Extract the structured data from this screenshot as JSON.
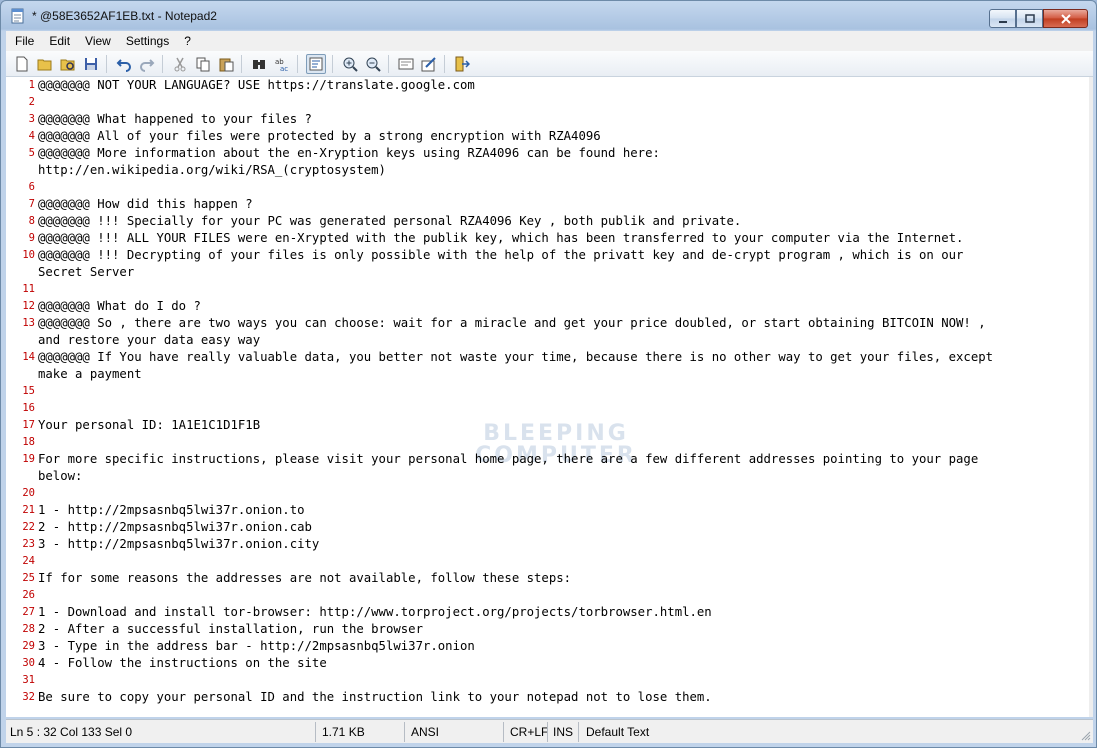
{
  "window": {
    "title": "* @58E3652AF1EB.txt - Notepad2"
  },
  "menu": [
    "File",
    "Edit",
    "View",
    "Settings",
    "?"
  ],
  "toolbar": {
    "buttons": [
      "new-icon",
      "open-icon",
      "browse-icon",
      "save-icon",
      "undo-icon",
      "redo-icon",
      "cut-icon",
      "copy-icon",
      "paste-icon",
      "find-icon",
      "replace-icon",
      "word-wrap-icon",
      "zoom-in-icon",
      "zoom-out-icon",
      "scheme-icon",
      "customize-icon",
      "exit-icon"
    ]
  },
  "editor": {
    "lines": [
      {
        "n": "1",
        "text": "@@@@@@@ NOT YOUR LANGUAGE? USE https://translate.google.com"
      },
      {
        "n": "2",
        "text": ""
      },
      {
        "n": "3",
        "text": "@@@@@@@ What happened to your files ?"
      },
      {
        "n": "4",
        "text": "@@@@@@@ All of your files were protected by a strong encryption with RZA4096"
      },
      {
        "n": "5",
        "text": "@@@@@@@ More information about the en-Xryption keys using RZA4096 can be found here:"
      },
      {
        "n": "",
        "text": "http://en.wikipedia.org/wiki/RSA_(cryptosystem)"
      },
      {
        "n": "6",
        "text": ""
      },
      {
        "n": "7",
        "text": "@@@@@@@ How did this happen ?"
      },
      {
        "n": "8",
        "text": "@@@@@@@ !!! Specially for your PC was generated personal RZA4096 Key , both publik and private."
      },
      {
        "n": "9",
        "text": "@@@@@@@ !!! ALL YOUR FILES were en-Xrypted with the publik key, which has been transferred to your computer via the Internet."
      },
      {
        "n": "10",
        "text": "@@@@@@@ !!! Decrypting of your files is only possible with the help of the privatt key and de-crypt program , which is on our"
      },
      {
        "n": "",
        "text": "Secret Server"
      },
      {
        "n": "11",
        "text": ""
      },
      {
        "n": "12",
        "text": "@@@@@@@ What do I do ?"
      },
      {
        "n": "13",
        "text": "@@@@@@@ So , there are two ways you can choose: wait for a miracle and get your price doubled, or start obtaining BITCOIN NOW! ,"
      },
      {
        "n": "",
        "text": "and restore your data easy way"
      },
      {
        "n": "14",
        "text": "@@@@@@@ If You have really valuable data, you better not waste your time, because there is no other way to get your files, except"
      },
      {
        "n": "",
        "text": "make a payment"
      },
      {
        "n": "15",
        "text": ""
      },
      {
        "n": "16",
        "text": ""
      },
      {
        "n": "17",
        "text": "Your personal ID: 1A1E1C1D1F1B"
      },
      {
        "n": "18",
        "text": ""
      },
      {
        "n": "19",
        "text": "For more specific instructions, please visit your personal home page, there are a few different addresses pointing to your page"
      },
      {
        "n": "",
        "text": "below:"
      },
      {
        "n": "20",
        "text": ""
      },
      {
        "n": "21",
        "text": "1 - http://2mpsasnbq5lwi37r.onion.to"
      },
      {
        "n": "22",
        "text": "2 - http://2mpsasnbq5lwi37r.onion.cab"
      },
      {
        "n": "23",
        "text": "3 - http://2mpsasnbq5lwi37r.onion.city"
      },
      {
        "n": "24",
        "text": ""
      },
      {
        "n": "25",
        "text": "If for some reasons the addresses are not available, follow these steps:"
      },
      {
        "n": "26",
        "text": ""
      },
      {
        "n": "27",
        "text": "1 - Download and install tor-browser: http://www.torproject.org/projects/torbrowser.html.en"
      },
      {
        "n": "28",
        "text": "2 - After a successful installation, run the browser"
      },
      {
        "n": "29",
        "text": "3 - Type in the address bar - http://2mpsasnbq5lwi37r.onion"
      },
      {
        "n": "30",
        "text": "4 - Follow the instructions on the site"
      },
      {
        "n": "31",
        "text": ""
      },
      {
        "n": "32",
        "text": "Be sure to copy your personal ID and the instruction link to your notepad not to lose them."
      }
    ],
    "watermark": [
      "BLEEPING",
      "COMPUTER"
    ]
  },
  "status": {
    "position": "Ln 5 : 32   Col 133   Sel 0",
    "size": "1.71 KB",
    "encoding": "ANSI",
    "line_ending": "CR+LF",
    "mode": "INS",
    "scheme": "Default Text"
  },
  "colors": {
    "line_numbers": "#c00000",
    "titlebar": "#b9cde6"
  }
}
